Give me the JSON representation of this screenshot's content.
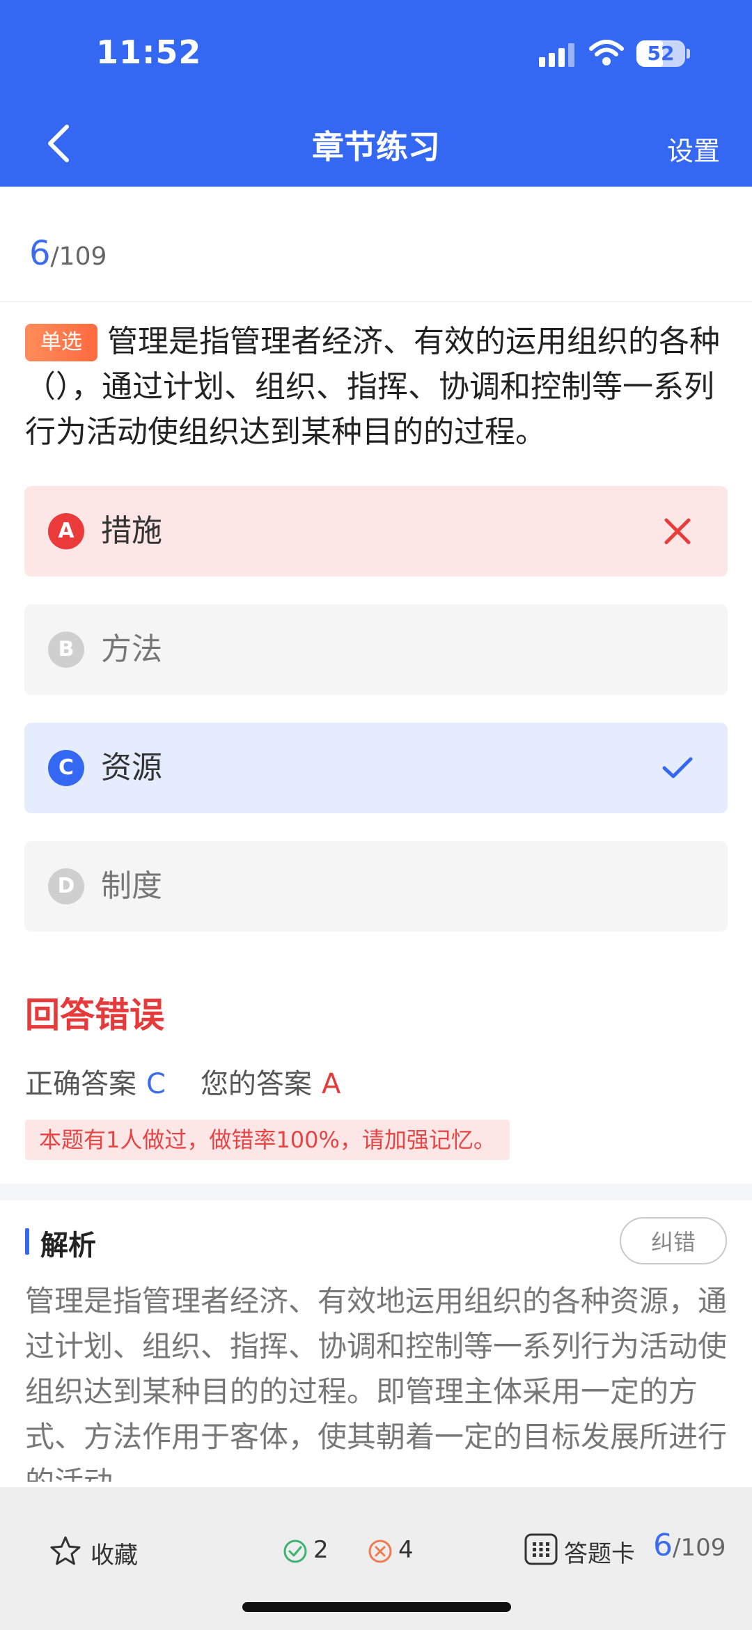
{
  "status_bar": {
    "time": "11:52",
    "battery": "52"
  },
  "header": {
    "title": "章节练习",
    "settings_label": "设置"
  },
  "progress": {
    "current": "6",
    "total": "/109"
  },
  "question": {
    "type_badge": "单选",
    "text": "管理是指管理者经济、有效的运用组织的各种（），通过计划、组织、指挥、协调和控制等一系列行为活动使组织达到某种目的的过程。"
  },
  "options": [
    {
      "letter": "A",
      "label": "措施",
      "state": "wrong"
    },
    {
      "letter": "B",
      "label": "方法",
      "state": "normal"
    },
    {
      "letter": "C",
      "label": "资源",
      "state": "correct"
    },
    {
      "letter": "D",
      "label": "制度",
      "state": "normal"
    }
  ],
  "result": {
    "title": "回答错误",
    "correct_label": "正确答案",
    "correct_value": "C",
    "your_label": "您的答案",
    "your_value": "A",
    "hint": "本题有1人做过，做错率100%，请加强记忆。"
  },
  "analysis": {
    "title": "解析",
    "report_button": "纠错",
    "text": "管理是指管理者经济、有效地运用组织的各种资源，通过计划、组织、指挥、协调和控制等一系列行为活动使组织达到某种目的的过程。即管理主体采用一定的方式、方法作用于客体，使其朝着一定的目标发展所进行的活动。"
  },
  "bottom_bar": {
    "favorite_label": "收藏",
    "correct_count": "2",
    "wrong_count": "4",
    "answer_card_label": "答题卡",
    "progress_current": "6",
    "progress_total": "/109"
  },
  "colors": {
    "primary": "#3467f2",
    "wrong": "#ea3a3a",
    "correct_count": "#3cb371",
    "wrong_count": "#f07b4f"
  }
}
